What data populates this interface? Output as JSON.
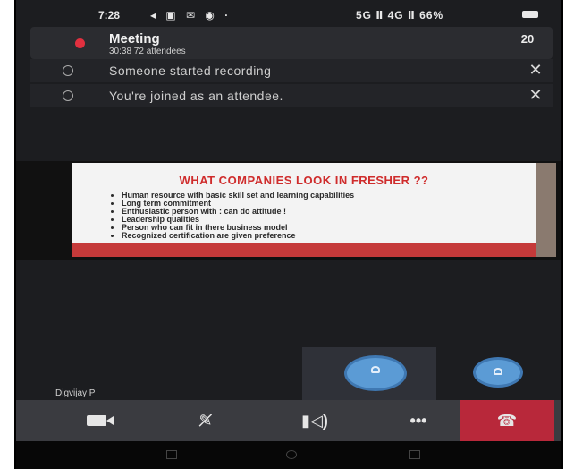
{
  "status_bar": {
    "time": "7:28",
    "right_text": "5G Ⅱ 4G Ⅱ 66%",
    "left_icons": [
      "signal-arrow-icon",
      "tablet-icon",
      "mail-icon",
      "camera-icon",
      "dot-icon"
    ]
  },
  "meeting": {
    "title": "Meeting",
    "subtitle": "30:38  72 attendees",
    "participants_count": "20"
  },
  "notifications": [
    {
      "text": "Someone started recording",
      "icon": "info-icon",
      "close": "✕"
    },
    {
      "text": "You're joined as an attendee.",
      "icon": "info-icon",
      "close": "✕"
    }
  ],
  "slide": {
    "title": "WHAT COMPANIES LOOK IN FRESHER ??",
    "bullets": [
      "Human resource with basic skill set and learning capabilities",
      "Long term commitment",
      "Enthusiastic person with : can do attitude !",
      "Leadership qualities",
      "Person who can fit in there business model",
      "Recognized certification are given preference"
    ]
  },
  "speaker": {
    "name": "Digvijay P"
  },
  "controls": {
    "more_label": "•••"
  },
  "colors": {
    "accent_red": "#b8283a",
    "avatar_blue": "#5b9bd5",
    "record_red": "#e2303f"
  }
}
